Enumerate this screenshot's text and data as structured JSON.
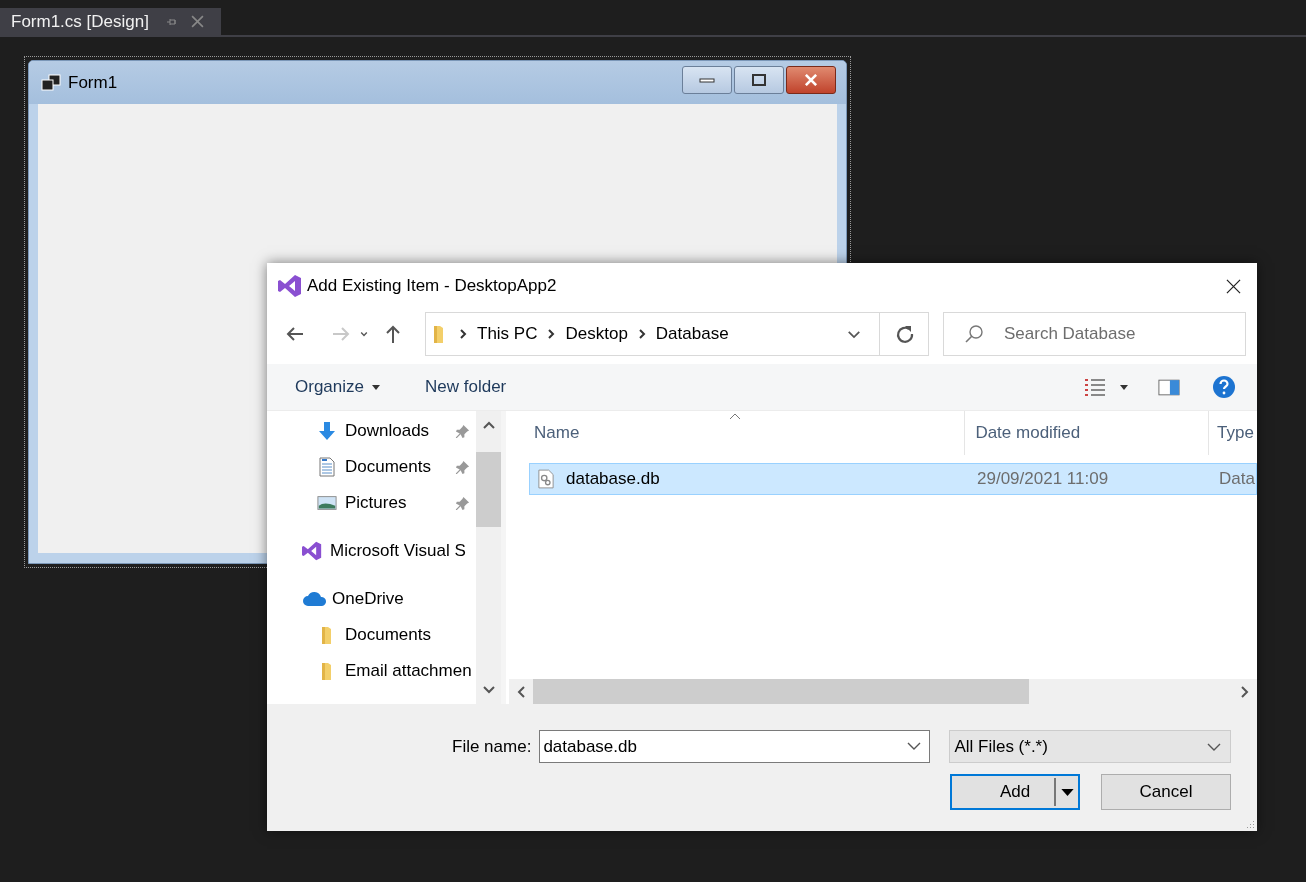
{
  "document_tab": {
    "title": "Form1.cs [Design]",
    "selected": true
  },
  "form": {
    "title": "Form1"
  },
  "dialog": {
    "title": "Add Existing Item - DesktopApp2",
    "nav_buttons": [
      {
        "kind": "back",
        "disabled": false
      },
      {
        "kind": "forward",
        "disabled": true
      },
      {
        "kind": "recent",
        "disabled": false
      },
      {
        "kind": "up",
        "disabled": false
      }
    ],
    "breadcrumb": [
      "This PC",
      "Desktop",
      "Database"
    ],
    "search": {
      "placeholder": "Search Database"
    },
    "toolbar": {
      "organize": "Organize",
      "new_folder": "New folder"
    },
    "nav_pane": [
      {
        "children": [
          {
            "label": "Downloads",
            "kind": "download",
            "pinned": true
          },
          {
            "label": "Documents",
            "kind": "document",
            "pinned": true
          },
          {
            "label": "Pictures",
            "kind": "pictures",
            "pinned": true
          }
        ]
      },
      {
        "label": "Microsoft Visual S",
        "kind": "vs"
      },
      {
        "label": "OneDrive",
        "kind": "cloud",
        "children": [
          {
            "label": "Documents",
            "kind": "folder"
          },
          {
            "label": "Email attachmen",
            "kind": "folder"
          }
        ]
      }
    ],
    "columns": [
      {
        "label": "Name",
        "sorted": true
      },
      {
        "label": "Date modified",
        "sorted": false
      },
      {
        "label": "Type",
        "sorted": false
      }
    ],
    "rows": [
      {
        "name": "database.db",
        "date": "29/09/2021 11:09",
        "type": "Data",
        "selected": true
      }
    ],
    "file_name_label": "File name:",
    "file_name": "database.db",
    "filter": "All Files (*.*)",
    "buttons": [
      {
        "label": "Add",
        "default": true,
        "split": true
      },
      {
        "label": "Cancel",
        "default": false,
        "split": false
      }
    ]
  }
}
